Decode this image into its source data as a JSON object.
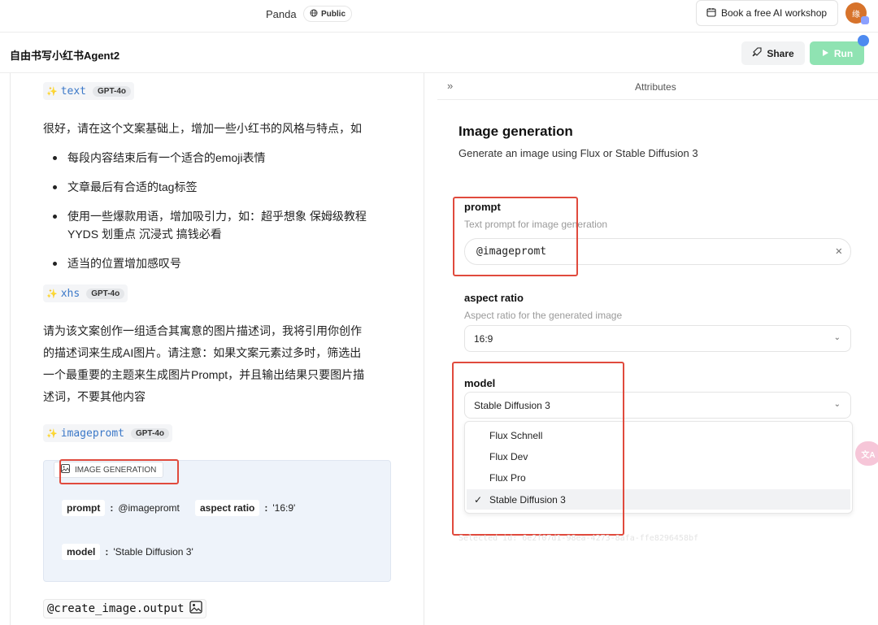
{
  "topbar": {
    "project": "Panda",
    "visibility": "Public",
    "workshop_label": "Book a free AI workshop",
    "avatar_text": "缘"
  },
  "header": {
    "title": "自由书写小红书Agent2",
    "share_label": "Share",
    "run_label": "Run"
  },
  "left": {
    "chip_text": {
      "name": "text",
      "model": "GPT-4o"
    },
    "para1": "很好，请在这个文案基础上，增加一些小红书的风格与特点，如",
    "bullets": [
      "每段内容结束后有一个适合的emoji表情",
      "文章最后有合适的tag标签",
      "使用一些爆款用语，增加吸引力，如：超乎想象 保姆级教程 YYDS 划重点 沉浸式 搞钱必看",
      "适当的位置增加感叹号"
    ],
    "chip_xhs": {
      "name": "xhs",
      "model": "GPT-4o"
    },
    "para2_lines": [
      "请为该文案创作一组适合其寓意的图片描述词，我将引用你创作",
      "的描述词来生成AI图片。请注意：如果文案元素过多时，筛选出",
      "一个最重要的主题来生成图片Prompt，并且输出结果只要图片描",
      "述词，不要其他内容"
    ],
    "chip_img": {
      "name": "imagepromt",
      "model": "GPT-4o"
    },
    "gen_card": {
      "tab": "IMAGE GENERATION",
      "prompt_key": "prompt",
      "prompt_val": "@imagepromt",
      "ratio_key": "aspect ratio",
      "ratio_val": "'16:9'",
      "model_key": "model",
      "model_val": "'Stable Diffusion 3'"
    },
    "output": "@create_image.output"
  },
  "right": {
    "panel_label": "Attributes",
    "title": "Image generation",
    "description": "Generate an image using Flux or Stable Diffusion 3",
    "prompt": {
      "label": "prompt",
      "hint": "Text prompt for image generation",
      "value": "@imagepromt"
    },
    "ratio": {
      "label": "aspect ratio",
      "hint": "Aspect ratio for the generated image",
      "value": "16:9"
    },
    "model": {
      "label": "model",
      "value": "Stable Diffusion 3",
      "options": [
        "Flux Schnell",
        "Flux Dev",
        "Flux Pro",
        "Stable Diffusion 3"
      ],
      "selected_index": 3
    },
    "selected_id": "Selected id: 6e2f07d1-98ea-4273-8afa-ffe8296458bf"
  },
  "translate_badge": "文A",
  "colors": {
    "accent_run": "#8fe3b2",
    "highlight_box": "#e04a3d",
    "chip_link": "#3b78c8"
  }
}
